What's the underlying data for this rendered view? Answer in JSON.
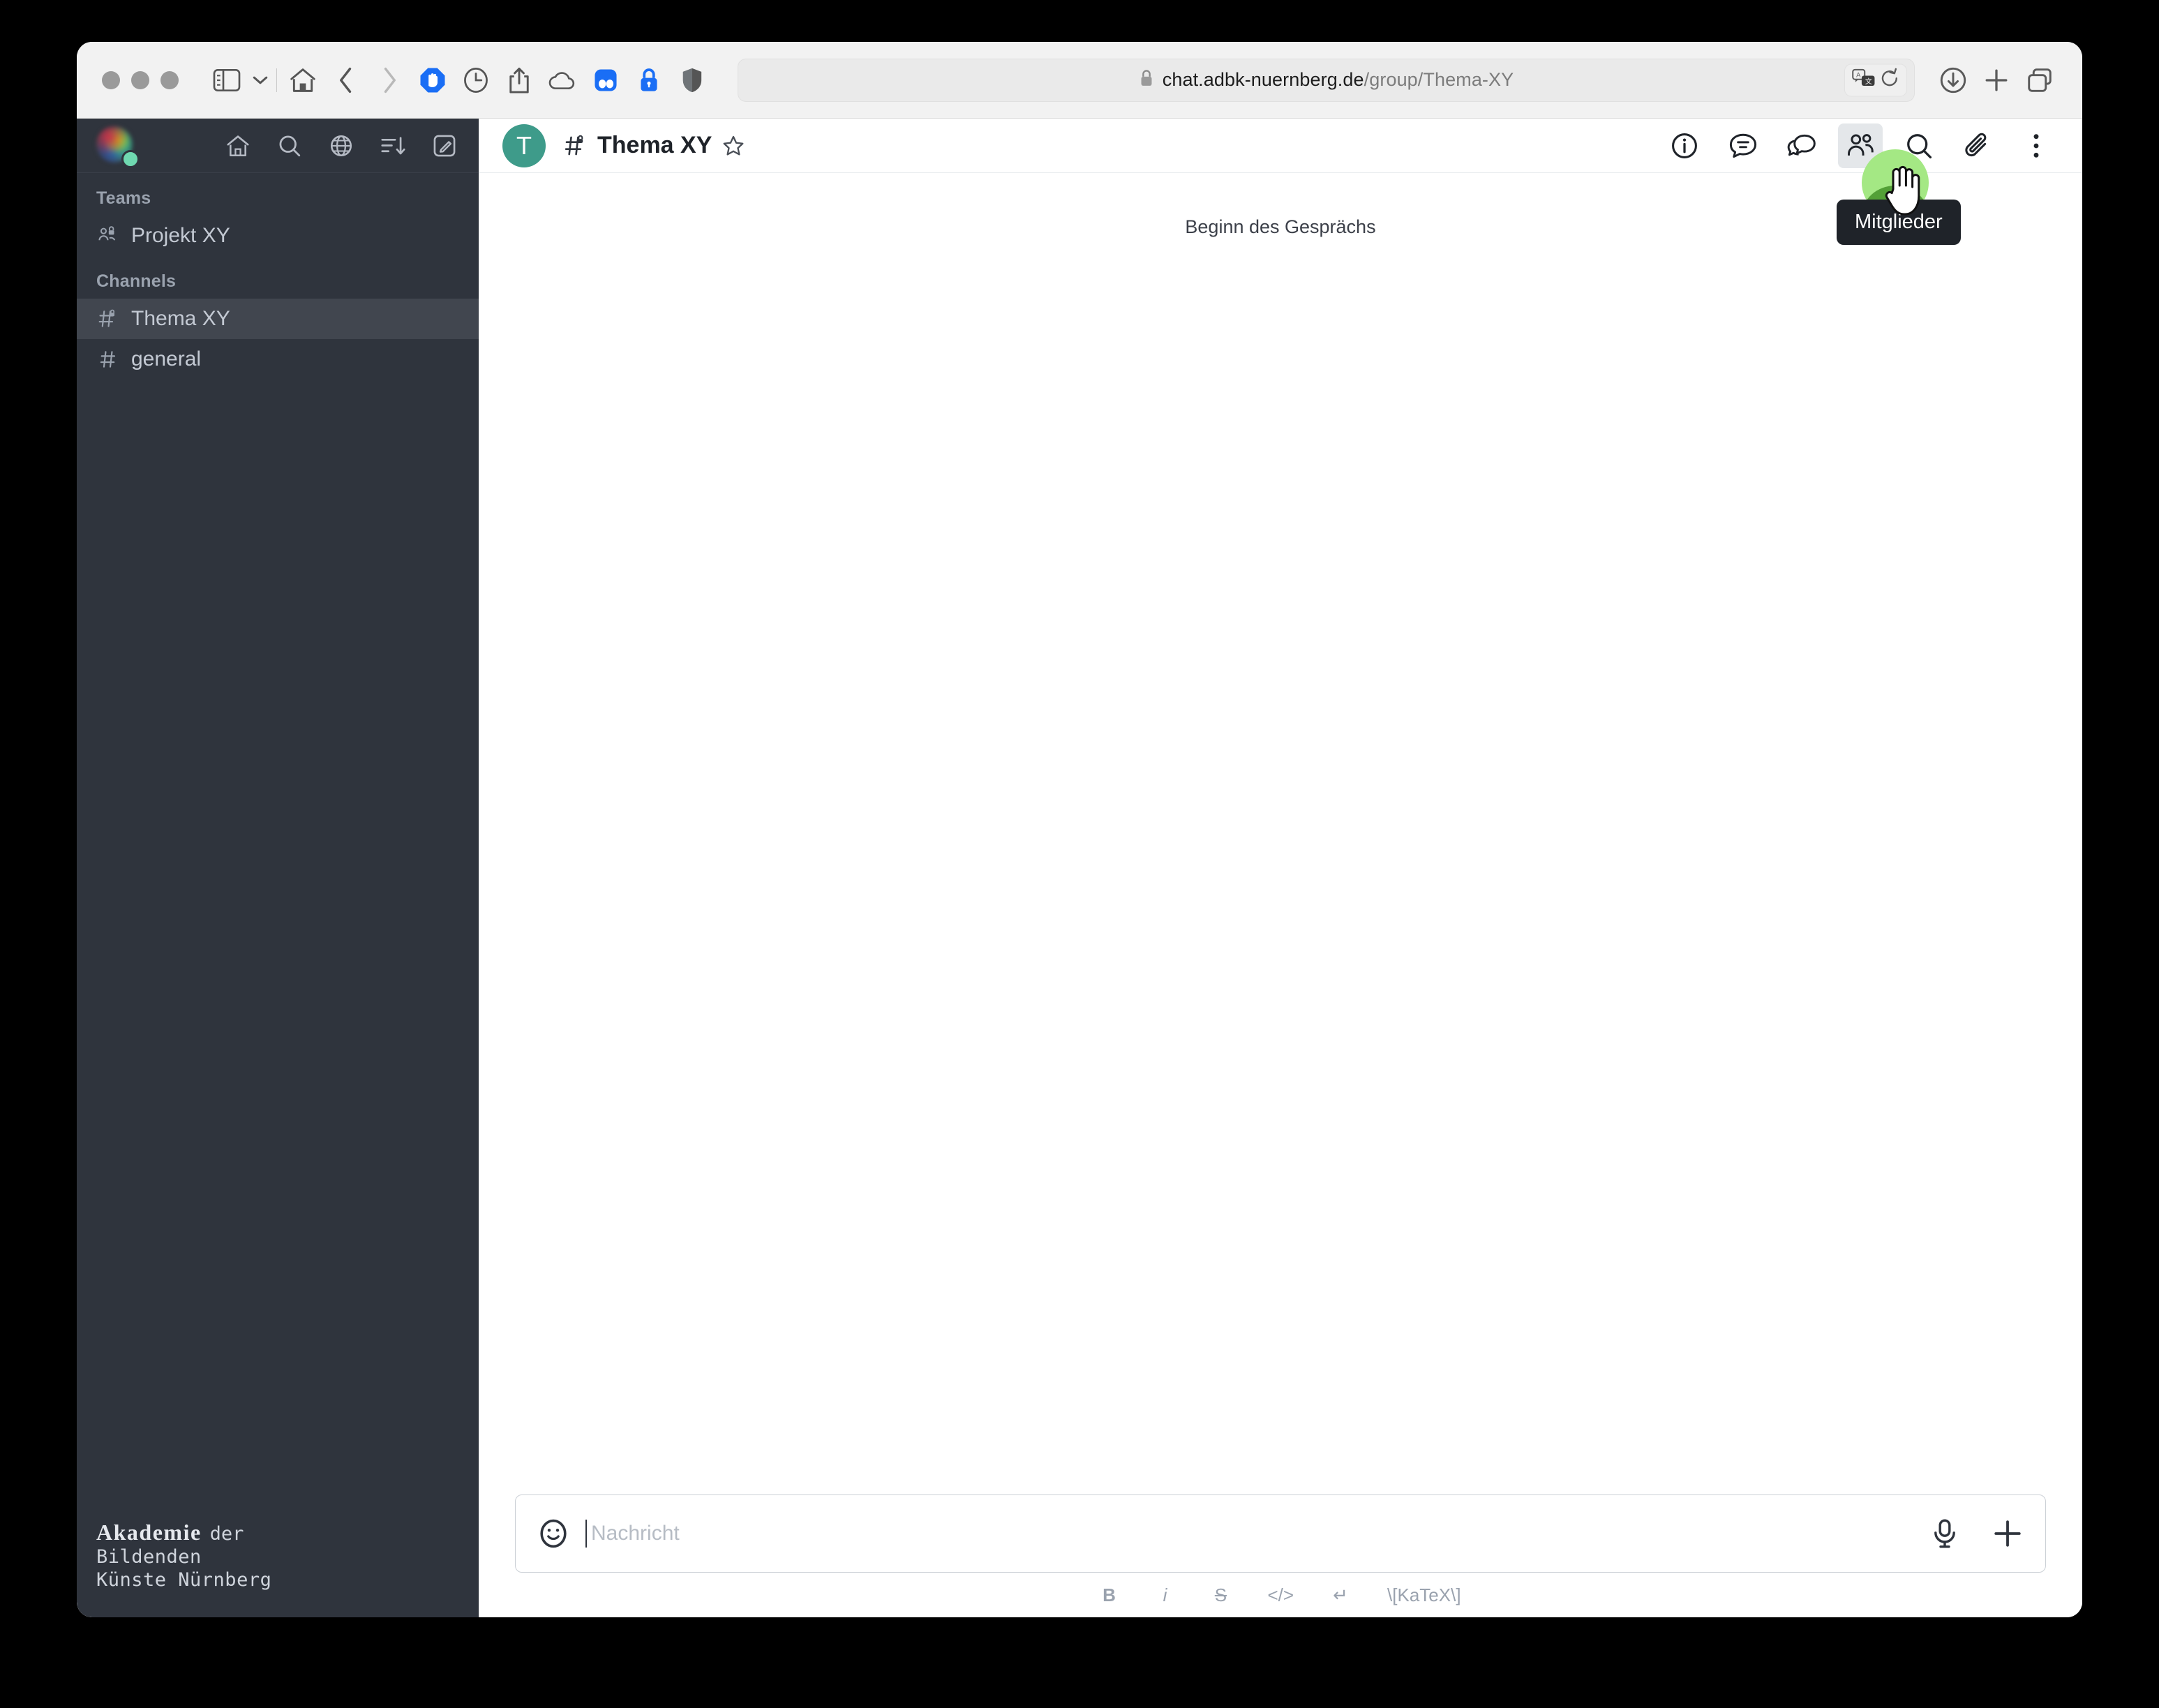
{
  "browser": {
    "url_prefix": "chat.adbk-nuernberg.de",
    "url_suffix": "/group/Thema-XY",
    "icons": {
      "sidebar_toggle": "sidebar-icon",
      "chevron": "chevron-down-icon",
      "home": "home-icon",
      "back": "back-icon",
      "forward": "forward-icon",
      "adblock": "adblock-shield-icon",
      "history": "history-clock-icon",
      "share": "share-icon",
      "icloud": "icloud-icon",
      "pocket": "pocket-extension-icon",
      "password": "password-lock-icon",
      "privacy": "privacy-shield-icon",
      "lock": "lock-icon",
      "translate": "translate-icon",
      "reload": "reload-icon",
      "downloads": "downloads-icon",
      "new_tab": "plus-icon",
      "tab_overview": "tab-overview-icon"
    }
  },
  "sidebar": {
    "top_icons": [
      "home-icon",
      "search-icon",
      "globe-icon",
      "sort-icon",
      "create-new-icon"
    ],
    "sections": [
      {
        "label": "Teams",
        "items": [
          {
            "label": "Projekt XY",
            "icon": "team-private-icon",
            "active": false
          }
        ]
      },
      {
        "label": "Channels",
        "items": [
          {
            "label": "Thema XY",
            "icon": "hash-lock-icon",
            "active": true
          },
          {
            "label": "general",
            "icon": "hash-icon",
            "active": false
          }
        ]
      }
    ],
    "footer_logo": {
      "line1_bold": "Akademie",
      "line1_rest": "der",
      "line2": "Bildenden",
      "line3": "Künste Nürnberg"
    }
  },
  "chat": {
    "avatar_letter": "T",
    "title": "Thema XY",
    "channel_icon": "hash-lock-icon",
    "favorite_icon": "star-outline-icon",
    "actions": [
      {
        "name": "kebab-info",
        "icon": "info-circle-icon",
        "tooltip": ""
      },
      {
        "name": "threads",
        "icon": "threads-icon",
        "tooltip": ""
      },
      {
        "name": "discussions",
        "icon": "discussion-icon",
        "tooltip": ""
      },
      {
        "name": "members",
        "icon": "members-icon",
        "tooltip": "Mitglieder"
      },
      {
        "name": "search",
        "icon": "search-icon",
        "tooltip": ""
      },
      {
        "name": "files",
        "icon": "paperclip-icon",
        "tooltip": ""
      },
      {
        "name": "options",
        "icon": "kebab-menu-icon",
        "tooltip": ""
      }
    ],
    "tooltip_text": "Mitglieder",
    "start_of_conversation": "Beginn des Gesprächs"
  },
  "composer": {
    "placeholder": "Nachricht",
    "value": "",
    "emoji_icon": "emoji-smiley-icon",
    "audio_icon": "microphone-icon",
    "plus_icon": "plus-icon",
    "format_buttons": [
      {
        "label": "B",
        "name": "bold"
      },
      {
        "label": "i",
        "name": "italic"
      },
      {
        "label": "S",
        "name": "strike"
      },
      {
        "label": "</>",
        "name": "code"
      },
      {
        "label": "↵",
        "name": "multiline"
      },
      {
        "label": "\\[KaTeX\\]",
        "name": "katex"
      }
    ]
  },
  "colors": {
    "sidebar_bg": "#2f343d",
    "sidebar_active": "#41464f",
    "avatar_teal": "#3e9b8a",
    "tooltip_bg": "#1f2329",
    "click_highlight": "#a4e884"
  }
}
